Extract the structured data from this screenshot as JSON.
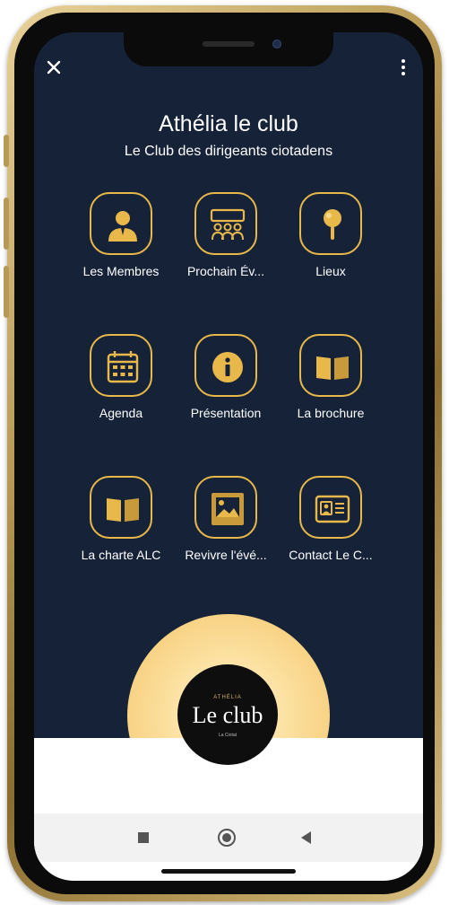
{
  "header": {
    "title": "Athélia le club",
    "subtitle": "Le Club des dirigeants ciotadens"
  },
  "tiles": [
    {
      "label": "Les Membres",
      "icon": "user-icon"
    },
    {
      "label": "Prochain Év...",
      "icon": "audience-icon"
    },
    {
      "label": "Lieux",
      "icon": "pin-icon"
    },
    {
      "label": "Agenda",
      "icon": "calendar-icon"
    },
    {
      "label": "Présentation",
      "icon": "info-icon"
    },
    {
      "label": "La brochure",
      "icon": "book-icon"
    },
    {
      "label": "La charte ALC",
      "icon": "book-icon"
    },
    {
      "label": "Revivre l'évé...",
      "icon": "image-icon"
    },
    {
      "label": "Contact Le C...",
      "icon": "contact-card-icon"
    }
  ],
  "logo": {
    "small": "ATHÉLIA",
    "main": "Le club",
    "tag": "La Ciotat"
  },
  "colors": {
    "background": "#152238",
    "accent": "#e8b84a",
    "glow": "#f5c46a"
  }
}
